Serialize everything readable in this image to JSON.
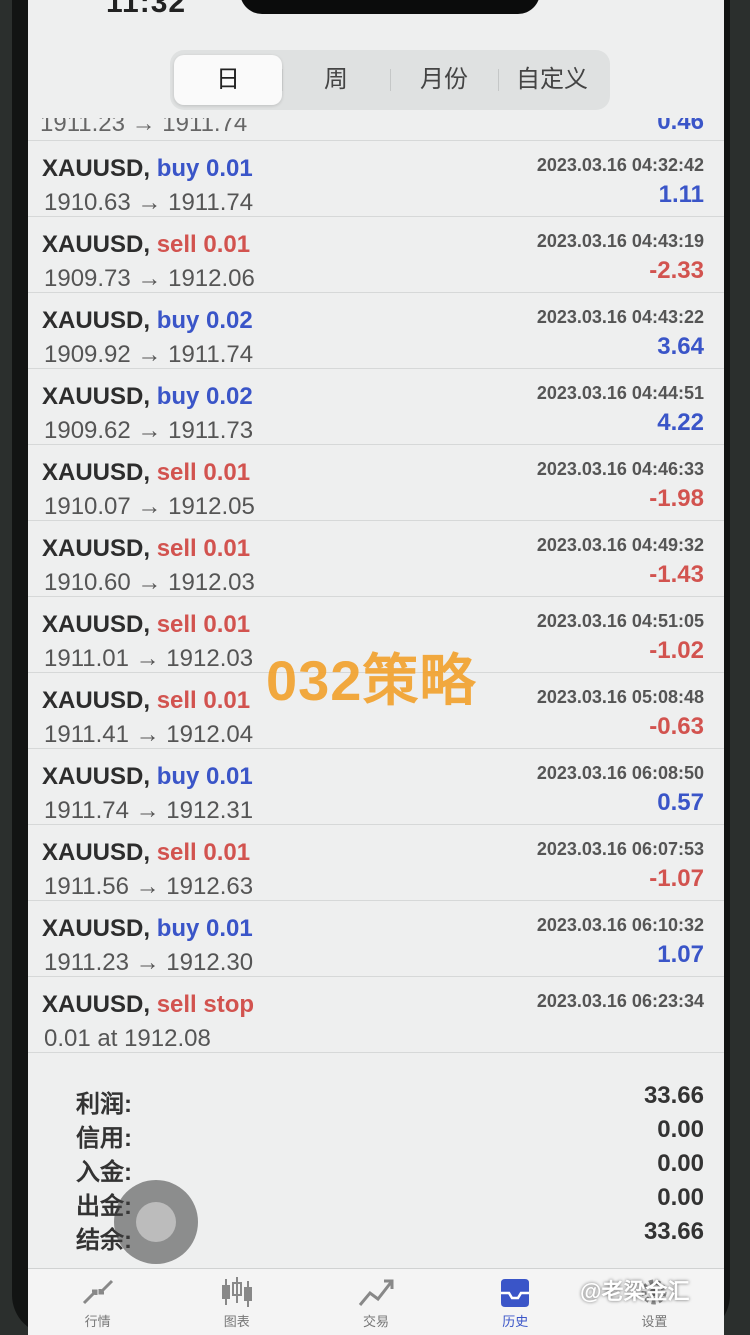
{
  "status": {
    "time": "11:32"
  },
  "period_tabs": [
    {
      "label": "日",
      "active": true
    },
    {
      "label": "周",
      "active": false
    },
    {
      "label": "月份",
      "active": false
    },
    {
      "label": "自定义",
      "active": false
    }
  ],
  "partial_top": {
    "prices": "1911.23 → 1911.74",
    "profit": "0.46"
  },
  "trades": [
    {
      "symbol": "XAUUSD,",
      "side": "buy 0.01",
      "dir": "buy",
      "prices": "1910.63 → 1911.74",
      "time": "2023.03.16 04:32:42",
      "profit": "1.11",
      "sign": "pos"
    },
    {
      "symbol": "XAUUSD,",
      "side": "sell 0.01",
      "dir": "sell",
      "prices": "1909.73 → 1912.06",
      "time": "2023.03.16 04:43:19",
      "profit": "-2.33",
      "sign": "neg"
    },
    {
      "symbol": "XAUUSD,",
      "side": "buy 0.02",
      "dir": "buy",
      "prices": "1909.92 → 1911.74",
      "time": "2023.03.16 04:43:22",
      "profit": "3.64",
      "sign": "pos"
    },
    {
      "symbol": "XAUUSD,",
      "side": "buy 0.02",
      "dir": "buy",
      "prices": "1909.62 → 1911.73",
      "time": "2023.03.16 04:44:51",
      "profit": "4.22",
      "sign": "pos"
    },
    {
      "symbol": "XAUUSD,",
      "side": "sell 0.01",
      "dir": "sell",
      "prices": "1910.07 → 1912.05",
      "time": "2023.03.16 04:46:33",
      "profit": "-1.98",
      "sign": "neg"
    },
    {
      "symbol": "XAUUSD,",
      "side": "sell 0.01",
      "dir": "sell",
      "prices": "1910.60 → 1912.03",
      "time": "2023.03.16 04:49:32",
      "profit": "-1.43",
      "sign": "neg"
    },
    {
      "symbol": "XAUUSD,",
      "side": "sell 0.01",
      "dir": "sell",
      "prices": "1911.01 → 1912.03",
      "time": "2023.03.16 04:51:05",
      "profit": "-1.02",
      "sign": "neg"
    },
    {
      "symbol": "XAUUSD,",
      "side": "sell 0.01",
      "dir": "sell",
      "prices": "1911.41 → 1912.04",
      "time": "2023.03.16 05:08:48",
      "profit": "-0.63",
      "sign": "neg"
    },
    {
      "symbol": "XAUUSD,",
      "side": "buy 0.01",
      "dir": "buy",
      "prices": "1911.74 → 1912.31",
      "time": "2023.03.16 06:08:50",
      "profit": "0.57",
      "sign": "pos"
    },
    {
      "symbol": "XAUUSD,",
      "side": "sell 0.01",
      "dir": "sell",
      "prices": "1911.56 → 1912.63",
      "time": "2023.03.16 06:07:53",
      "profit": "-1.07",
      "sign": "neg"
    },
    {
      "symbol": "XAUUSD,",
      "side": "buy 0.01",
      "dir": "buy",
      "prices": "1911.23 → 1912.30",
      "time": "2023.03.16 06:10:32",
      "profit": "1.07",
      "sign": "pos"
    },
    {
      "symbol": "XAUUSD,",
      "side": "sell stop",
      "dir": "sell",
      "prices": "0.01 at 1912.08",
      "time": "2023.03.16 06:23:34",
      "profit": "",
      "sign": "pos"
    }
  ],
  "summary": [
    {
      "label": "利润:",
      "value": "33.66"
    },
    {
      "label": "信用:",
      "value": "0.00"
    },
    {
      "label": "入金:",
      "value": "0.00"
    },
    {
      "label": "出金:",
      "value": "0.00"
    },
    {
      "label": "结余:",
      "value": "33.66"
    }
  ],
  "watermark": "032策略",
  "tabs": [
    {
      "label": "行情",
      "icon": "trend-arrows-icon"
    },
    {
      "label": "图表",
      "icon": "candlestick-icon"
    },
    {
      "label": "交易",
      "icon": "trade-line-icon"
    },
    {
      "label": "历史",
      "icon": "history-tray-icon",
      "active": true
    },
    {
      "label": "设置",
      "icon": "gear-icon"
    }
  ],
  "credit": "@老梁金汇",
  "colors": {
    "buy": "#3a55c8",
    "sell": "#d2534f",
    "watermark": "#f2a22f"
  }
}
